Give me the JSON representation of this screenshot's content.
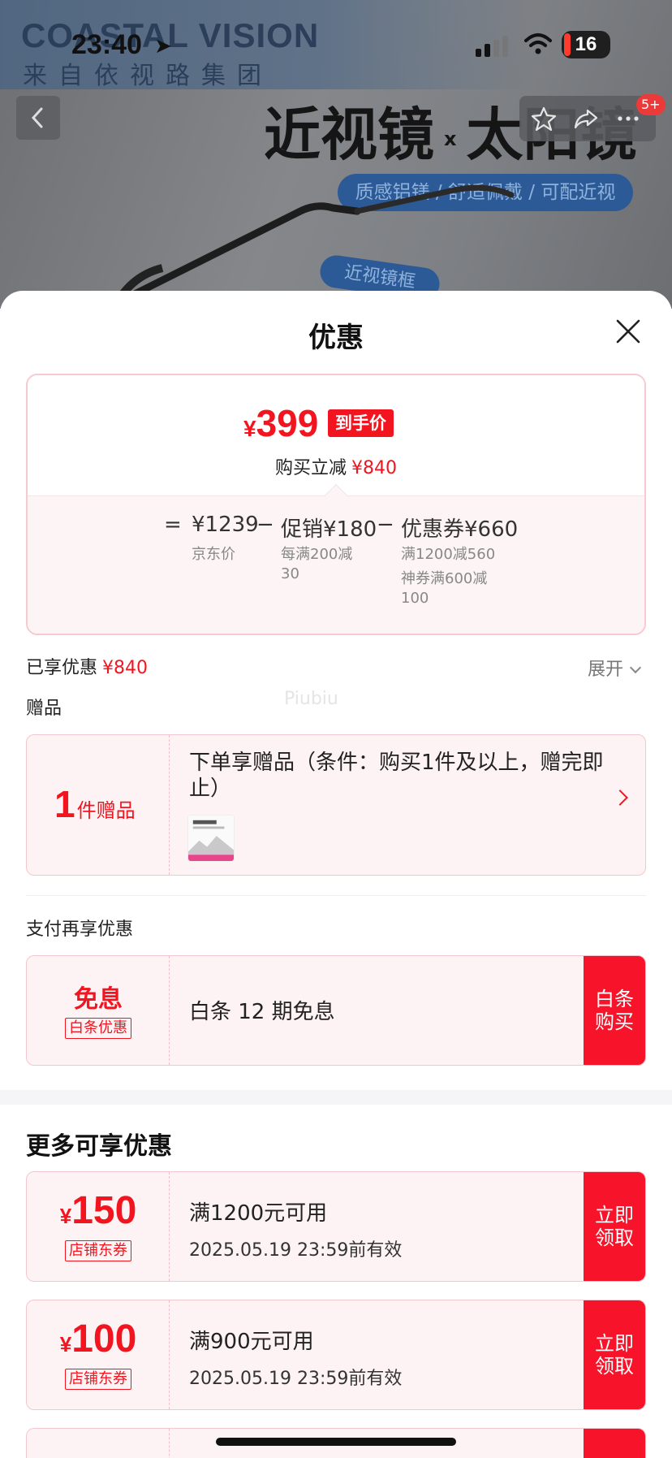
{
  "status_bar": {
    "time": "23:40",
    "battery": "16"
  },
  "banner": {
    "brand": "COASTAL VISION",
    "brand_sub": "来自依视路集团",
    "hero_left": "近视镜",
    "hero_x": "x",
    "hero_right": "太阳镜",
    "pill": "质感铝镁 / 舒适佩戴 / 可配近视",
    "tag": "近视镜框",
    "badge": "5+"
  },
  "sheet": {
    "title": "优惠",
    "price": {
      "currency": "¥",
      "value": "399",
      "tag": "到手价",
      "reduce_label": "购买立减",
      "reduce_value": "¥840"
    },
    "formula": {
      "eq": "=",
      "jd_price": "¥1239",
      "jd_label": "京东价",
      "minus1": "−",
      "promo": "促销¥180",
      "promo_note_1": "每满200减",
      "promo_note_2": "30",
      "minus2": "−",
      "coupon": "优惠券¥660",
      "coupon_note_1": "满1200减560",
      "coupon_note_2": "神券满600减",
      "coupon_note_3": "100"
    },
    "enjoyed": {
      "label": "已享优惠",
      "value": "¥840",
      "expand": "展开"
    },
    "watermark": "Piubiu",
    "gift_section": "赠品",
    "gift": {
      "count": "1",
      "count_unit": "件赠品",
      "text": "下单享赠品（条件：购买1件及以上，赠完即止）"
    },
    "pay_section": "支付再享优惠",
    "pay_coupon": {
      "title": "免息",
      "tag": "白条优惠",
      "text": "白条 12 期免息",
      "button": "白条购买"
    },
    "more_title": "更多可享优惠",
    "coupons": [
      {
        "currency": "¥",
        "amount": "150",
        "tag": "店铺东券",
        "condition": "满1200元可用",
        "expiry": "2025.05.19 23:59前有效",
        "button": "立即领取"
      },
      {
        "currency": "¥",
        "amount": "100",
        "tag": "店铺东券",
        "condition": "满900元可用",
        "expiry": "2025.05.19 23:59前有效",
        "button": "立即领取"
      }
    ]
  },
  "colors": {
    "accent": "#f2151f",
    "card_bg": "#fdf3f4",
    "card_border": "#f4c6cd"
  }
}
